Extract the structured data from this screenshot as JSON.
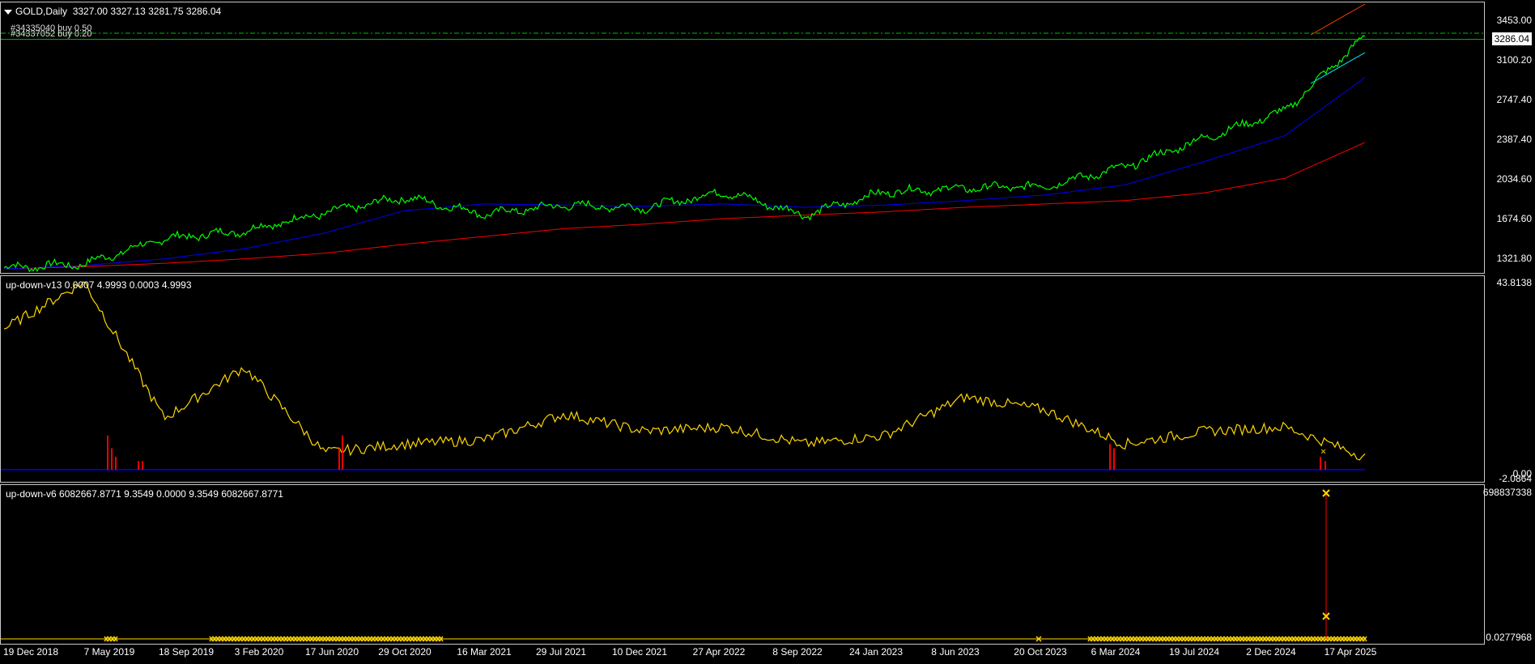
{
  "main": {
    "title_symbol": "GOLD,Daily",
    "ohlc": "3327.00 3327.13 3281.75 3286.04",
    "orders": [
      "#34335040 buy 0.50",
      "#34337052 buy 0.20"
    ],
    "current_price": "3286.04",
    "y_labels": [
      "3453.00",
      "3100.20",
      "2747.40",
      "2387.40",
      "2034.60",
      "1674.60",
      "1321.80"
    ]
  },
  "ind1": {
    "title": "up-down-v13 0.0007 4.9993 0.0003 4.9993",
    "y_top": "43.8138",
    "y_bottom_a": "0.00",
    "y_bottom_b": "-2.0864"
  },
  "ind2": {
    "title": "up-down-v6 6082667.8771 9.3549 0.0000 9.3549 6082667.8771",
    "y_top": "698837338",
    "y_bottom": "0.0277968"
  },
  "x_labels": [
    "19 Dec 2018",
    "7 May 2019",
    "18 Sep 2019",
    "3 Feb 2020",
    "17 Jun 2020",
    "29 Oct 2020",
    "16 Mar 2021",
    "29 Jul 2021",
    "10 Dec 2021",
    "27 Apr 2022",
    "8 Sep 2022",
    "24 Jan 2023",
    "8 Jun 2023",
    "20 Oct 2023",
    "6 Mar 2024",
    "19 Jul 2024",
    "2 Dec 2024",
    "17 Apr 2025"
  ],
  "colors": {
    "price": "#00ff00",
    "ma_fast": "#0000ff",
    "ma_slow": "#ff0000",
    "osc": "#ffd700",
    "hist": "#ff0000",
    "order_line": "#00c000",
    "channel_up": "#ff4000",
    "channel_dn": "#00ffff"
  },
  "chart_data": [
    {
      "type": "line",
      "name": "price",
      "x": [
        "19 Dec 2018",
        "7 May 2019",
        "18 Sep 2019",
        "3 Feb 2020",
        "17 Jun 2020",
        "29 Oct 2020",
        "16 Mar 2021",
        "29 Jul 2021",
        "10 Dec 2021",
        "27 Apr 2022",
        "8 Sep 2022",
        "24 Jan 2023",
        "8 Jun 2023",
        "20 Oct 2023",
        "6 Mar 2024",
        "19 Jul 2024",
        "2 Dec 2024",
        "17 Apr 2025"
      ],
      "series": [
        {
          "values": [
            1250,
            1285,
            1510,
            1580,
            1740,
            1880,
            1730,
            1810,
            1785,
            1930,
            1720,
            1930,
            1960,
            1980,
            2150,
            2410,
            2650,
            3320
          ]
        },
        {
          "values": [
            1240,
            1270,
            1330,
            1420,
            1560,
            1760,
            1820,
            1810,
            1800,
            1820,
            1790,
            1810,
            1850,
            1900,
            1990,
            2200,
            2430,
            2950
          ]
        },
        {
          "values": [
            1240,
            1260,
            1290,
            1330,
            1380,
            1460,
            1530,
            1600,
            1640,
            1690,
            1720,
            1750,
            1790,
            1820,
            1850,
            1920,
            2050,
            2370
          ]
        }
      ],
      "ylim": [
        1190,
        3620
      ]
    },
    {
      "type": "line",
      "name": "up-down-v13",
      "x": [
        "19 Dec 2018",
        "7 May 2019",
        "18 Sep 2019",
        "3 Feb 2020",
        "17 Jun 2020",
        "29 Oct 2020",
        "16 Mar 2021",
        "29 Jul 2021",
        "10 Dec 2021",
        "27 Apr 2022",
        "8 Sep 2022",
        "24 Jan 2023",
        "8 Jun 2023",
        "20 Oct 2023",
        "6 Mar 2024",
        "19 Jul 2024",
        "2 Dec 2024",
        "17 Apr 2025"
      ],
      "values": [
        33,
        44,
        12,
        24,
        4,
        6,
        7,
        13,
        9,
        10,
        6,
        8,
        17,
        14,
        6,
        9,
        10,
        3
      ],
      "ylim": [
        -2.0864,
        43.8138
      ]
    },
    {
      "type": "scatter",
      "name": "up-down-v6",
      "spike_at": "17 Apr 2025",
      "values": [
        0.03,
        0.03,
        0.03,
        0.03,
        0.03,
        0.03,
        0,
        0,
        0,
        0,
        0,
        0,
        0,
        0.03,
        0.03,
        0.03,
        0.03,
        698837338
      ],
      "ylim": [
        0.0277968,
        698837338
      ]
    }
  ]
}
